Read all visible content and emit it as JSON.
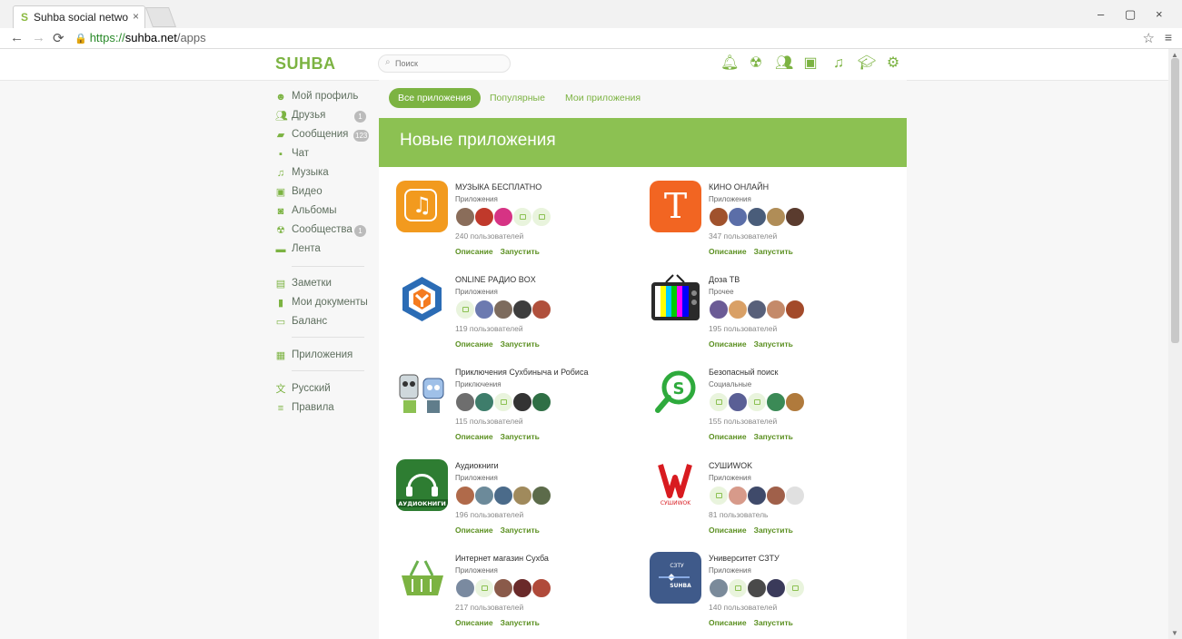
{
  "browser": {
    "tab_title": "Suhba social network",
    "tab_favicon": "S",
    "url_scheme": "https://",
    "url_host": "suhba.net",
    "url_path": "/apps",
    "minimize": "–",
    "restore": "▢",
    "close": "×"
  },
  "site": {
    "logo": "SUHBA",
    "search_placeholder": "Поиск",
    "accent": "#7cb342"
  },
  "top_icons": [
    "notifications-icon",
    "communities-icon",
    "friends-icon",
    "video-icon",
    "music-icon",
    "education-icon",
    "settings-icon"
  ],
  "sidebar": {
    "items": [
      {
        "label": "Мой профиль",
        "icon": "profile-icon"
      },
      {
        "label": "Друзья",
        "icon": "friends-icon",
        "badge": "1"
      },
      {
        "label": "Сообщения",
        "icon": "messages-icon",
        "badge": "123"
      },
      {
        "label": "Чат",
        "icon": "chat-icon"
      },
      {
        "label": "Музыка",
        "icon": "music-icon"
      },
      {
        "label": "Видео",
        "icon": "video-icon"
      },
      {
        "label": "Альбомы",
        "icon": "camera-icon"
      },
      {
        "label": "Сообщества",
        "icon": "communities-icon",
        "badge": "1"
      },
      {
        "label": "Лента",
        "icon": "feed-icon"
      },
      {
        "label": "Заметки",
        "icon": "notes-icon"
      },
      {
        "label": "Мои документы",
        "icon": "documents-icon"
      },
      {
        "label": "Баланс",
        "icon": "wallet-icon"
      },
      {
        "label": "Приложения",
        "icon": "apps-icon"
      },
      {
        "label": "Русский",
        "icon": "translate-icon"
      },
      {
        "label": "Правила",
        "icon": "rules-icon"
      }
    ]
  },
  "filters": {
    "all": "Все приложения",
    "popular": "Популярные",
    "mine": "Мои приложения"
  },
  "banner_title": "Новые приложения",
  "links": {
    "describe": "Описание",
    "launch": "Запустить"
  },
  "apps": [
    {
      "name": "МУЗЫКА БЕСПЛАТНО",
      "category": "Приложения",
      "users": "240 пользователей",
      "icon": "music-note-icon",
      "avatars": [
        "#8a6d5a",
        "#c0392b",
        "#d63384",
        "ph",
        "ph"
      ]
    },
    {
      "name": "КИНО ОНЛАЙН",
      "category": "Приложения",
      "users": "347 пользователей",
      "icon": "kino-t-icon",
      "avatars": [
        "#a0522d",
        "#5b6ea8",
        "#4a5d7a",
        "#b08d57",
        "#5a3b2e"
      ]
    },
    {
      "name": "ONLINE РАДИО BOX",
      "category": "Приложения",
      "users": "119 пользователей",
      "icon": "radio-cube-icon",
      "avatars": [
        "ph",
        "#6c7ab0",
        "#7d6b5d",
        "#3d3d3d",
        "#b0503c"
      ]
    },
    {
      "name": "Доза ТВ",
      "category": "Прочее",
      "users": "195 пользователей",
      "icon": "retro-tv-icon",
      "avatars": [
        "#6b5b95",
        "#d9a066",
        "#58607a",
        "#c48a6a",
        "#a34a2a"
      ]
    },
    {
      "name": "Приключения Сухбиныча и Робиса",
      "category": "Приключения",
      "users": "115 пользователей",
      "icon": "robots-icon",
      "avatars": [
        "#6e6e6e",
        "#3e7d6b",
        "ph",
        "#333333",
        "#2f6f45"
      ]
    },
    {
      "name": "Безопасный поиск",
      "category": "Социальные",
      "users": "155 пользователей",
      "icon": "safe-search-icon",
      "avatars": [
        "ph",
        "#5a5f95",
        "ph",
        "#3b8a56",
        "#b07a3c"
      ]
    },
    {
      "name": "Аудиокниги",
      "category": "Приложения",
      "users": "196 пользователей",
      "icon": "headphones-icon",
      "avatars": [
        "#b06a4a",
        "#6c8a9a",
        "#4b6b8a",
        "#a08a5c",
        "#5c6b4a"
      ]
    },
    {
      "name": "СУШИWOK",
      "category": "Приложения",
      "users": "81 пользователь",
      "icon": "sushiwok-icon",
      "avatars": [
        "ph",
        "#d79a8a",
        "#3f4a6a",
        "#a0604a",
        "#e0e0e0"
      ]
    },
    {
      "name": "Интернет магазин Сухба",
      "category": "Приложения",
      "users": "217 пользователей",
      "icon": "basket-icon",
      "avatars": [
        "#7a8aa0",
        "ph",
        "#8a5a4a",
        "#6a2a2a",
        "#b04a3a"
      ]
    },
    {
      "name": "Университет СЗТУ",
      "category": "Приложения",
      "users": "140 пользователей",
      "icon": "university-icon",
      "avatars": [
        "#7a8a9a",
        "ph",
        "#4a4a4a",
        "#3a3a5a",
        "ph"
      ]
    }
  ]
}
